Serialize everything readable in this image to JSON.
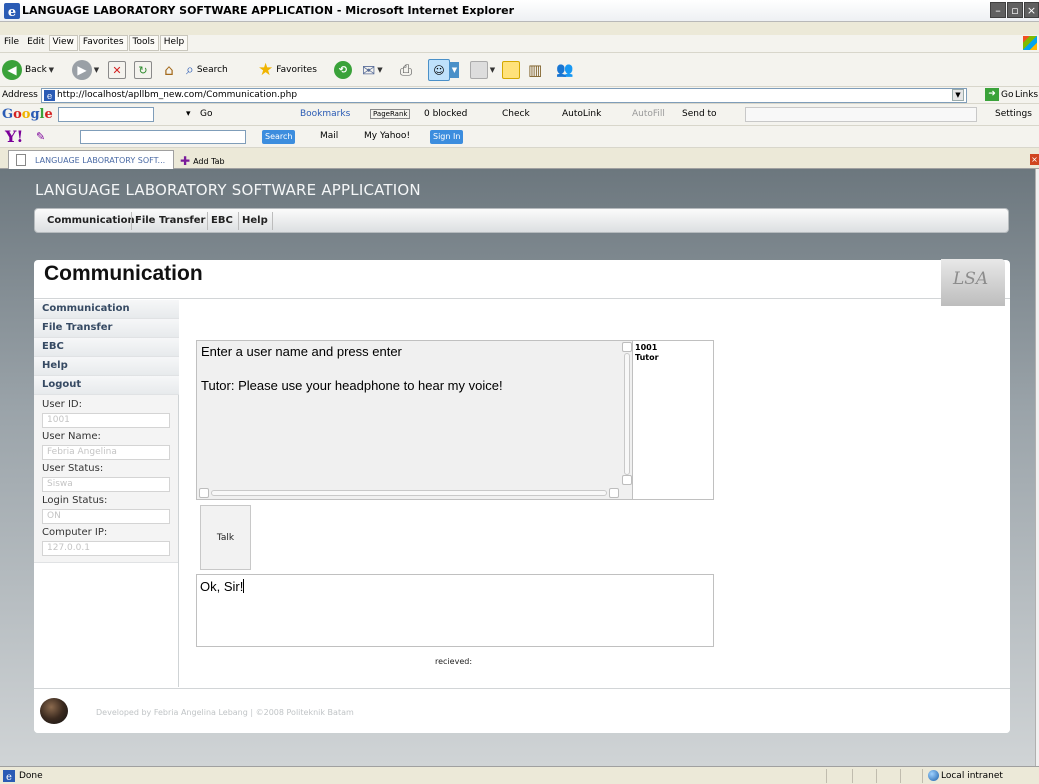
{
  "window": {
    "title": "LANGUAGE LABORATORY SOFTWARE APPLICATION - Microsoft Internet Explorer"
  },
  "menu": {
    "items": [
      "File",
      "Edit",
      "View",
      "Favorites",
      "Tools",
      "Help"
    ]
  },
  "toolbar": {
    "back_label": "Back",
    "search_label": "Search",
    "favorites_label": "Favorites"
  },
  "address": {
    "label": "Address",
    "url": "http://localhost/apllbm_new.com/Communication.php",
    "go_label": "Go",
    "links_label": "Links"
  },
  "google_bar": {
    "logo": "Google",
    "go_label": "Go",
    "bookmarks_label": "Bookmarks",
    "pagerank_label": "PageRank",
    "blocked_label": "0 blocked",
    "check_label": "Check",
    "autolink_label": "AutoLink",
    "autofill_label": "AutoFill",
    "sendto_label": "Send to",
    "settings_label": "Settings"
  },
  "yahoo_bar": {
    "logo": "Y!",
    "search_label": "Search",
    "mail_label": "Mail",
    "myyahoo_label": "My Yahoo!",
    "signin_label": "Sign In"
  },
  "tabs": {
    "active_label": "LANGUAGE LABORATORY SOFT...",
    "add_label": "Add Tab"
  },
  "app": {
    "title": "LANGUAGE LABORATORY SOFTWARE APPLICATION",
    "nav": [
      "Communication",
      "File Transfer",
      "EBC",
      "Help"
    ],
    "page_title": "Communication",
    "logo_text": "LSA",
    "sidebar": {
      "items": [
        "Communication",
        "File Transfer",
        "EBC",
        "Help",
        "Logout"
      ],
      "user_id_label": "User ID:",
      "user_id_value": "1001",
      "user_name_label": "User Name:",
      "user_name_value": "Febria Angelina",
      "user_status_label": "User Status:",
      "user_status_value": "Siswa",
      "login_status_label": "Login Status:",
      "login_status_value": "ON",
      "computer_ip_label": "Computer IP:",
      "computer_ip_value": "127.0.0.1"
    },
    "chat": {
      "line1": "Enter a user name and press enter",
      "line2": "Tutor: Please use your headphone to hear my voice!",
      "users": [
        "1001",
        "Tutor"
      ]
    },
    "talk_label": "Talk",
    "message_value": "Ok, Sir!",
    "received_label": "recieved:",
    "footer_credit": "Developed by Febria Angelina Lebang | ©2008 Politeknik Batam"
  },
  "status": {
    "text": "Done",
    "zone": "Local intranet"
  },
  "colors": {
    "page_background_top": "#6c777e",
    "sidebar_link": "#364a63",
    "yahoo_purple": "#7b0099"
  }
}
